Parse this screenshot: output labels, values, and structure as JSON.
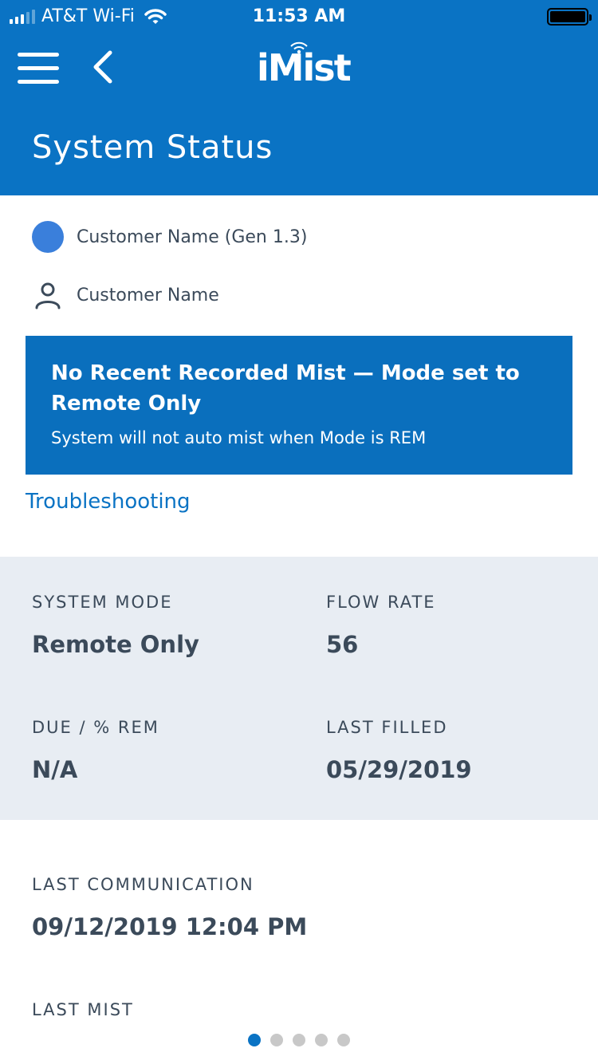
{
  "status_bar": {
    "carrier": "AT&T Wi-Fi",
    "time": "11:53 AM"
  },
  "header": {
    "logo": "iMist",
    "title": "System Status",
    "menu_icon": "hamburger-menu-icon",
    "back_icon": "chevron-left-icon"
  },
  "device": {
    "label": "Customer Name (Gen 1.3)",
    "status_color": "#3a7fdb"
  },
  "customer": {
    "icon": "person-icon",
    "label": "Customer Name"
  },
  "alert": {
    "title": "No Recent Recorded Mist — Mode set to Remote Only",
    "subtitle": "System will not auto mist when Mode is REM",
    "color": "#0a6fbd"
  },
  "troubleshooting_link": "Troubleshooting",
  "stats": {
    "system_mode": {
      "label": "SYSTEM MODE",
      "value": "Remote Only"
    },
    "flow_rate": {
      "label": "FLOW RATE",
      "value": "56"
    },
    "due_rem": {
      "label": "DUE / % REM",
      "value": "N/A"
    },
    "last_filled": {
      "label": "LAST FILLED",
      "value": "05/29/2019"
    }
  },
  "info": {
    "last_communication": {
      "label": "LAST COMMUNICATION",
      "value": "09/12/2019 12:04 PM"
    },
    "last_mist": {
      "label": "LAST MIST"
    }
  },
  "pager": {
    "count": 5,
    "active_index": 0
  },
  "colors": {
    "brand_blue": "#0a73c4",
    "stats_background": "#e8edf3",
    "text": "#3b4a5a"
  }
}
